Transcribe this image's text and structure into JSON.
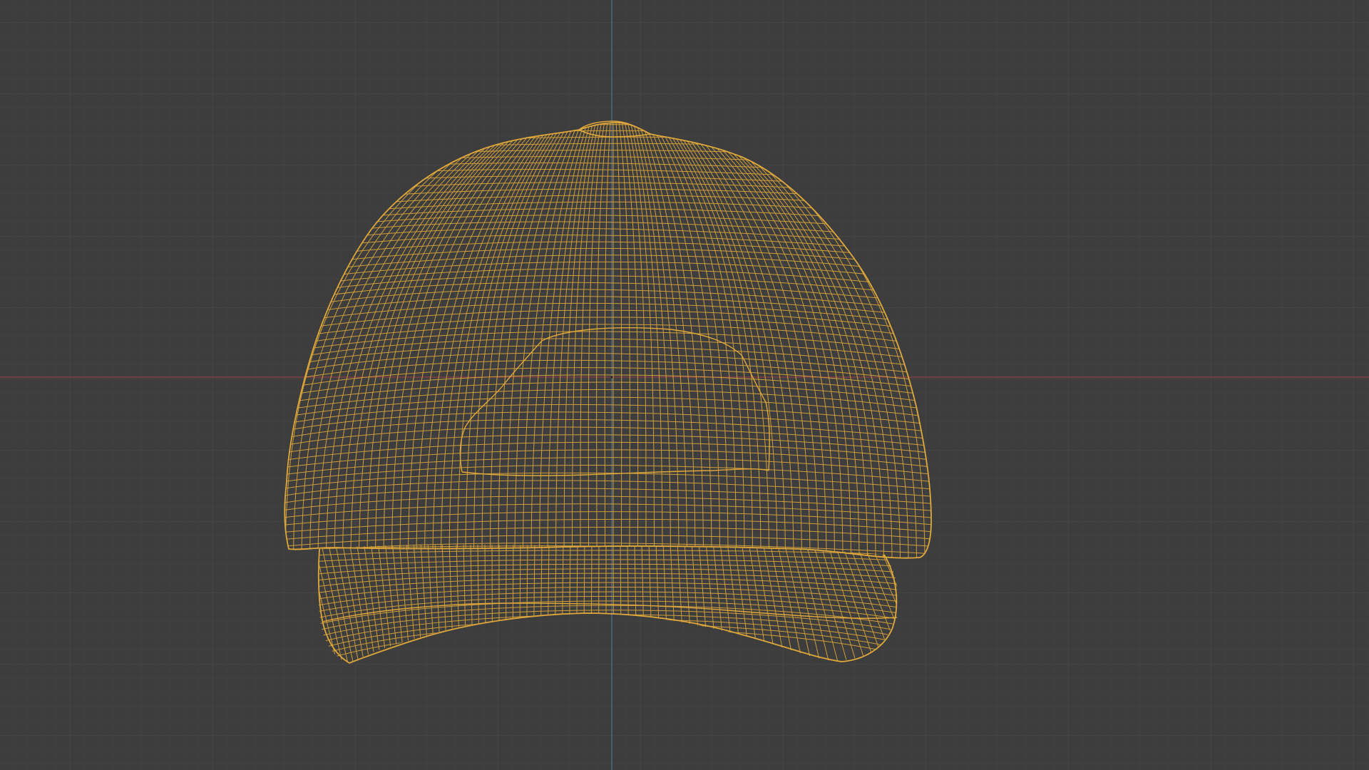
{
  "viewport": {
    "view": "front",
    "shading_mode": "wireframe",
    "object": {
      "name": "baseball-cap",
      "selected": true,
      "wire_color": "#e0a83a"
    },
    "colors": {
      "background": "#3d3d3d",
      "grid_minor": "#454545",
      "grid_major": "#4b4b4b",
      "axis_x": "#8b3f48",
      "axis_z": "#4f6a93"
    }
  }
}
